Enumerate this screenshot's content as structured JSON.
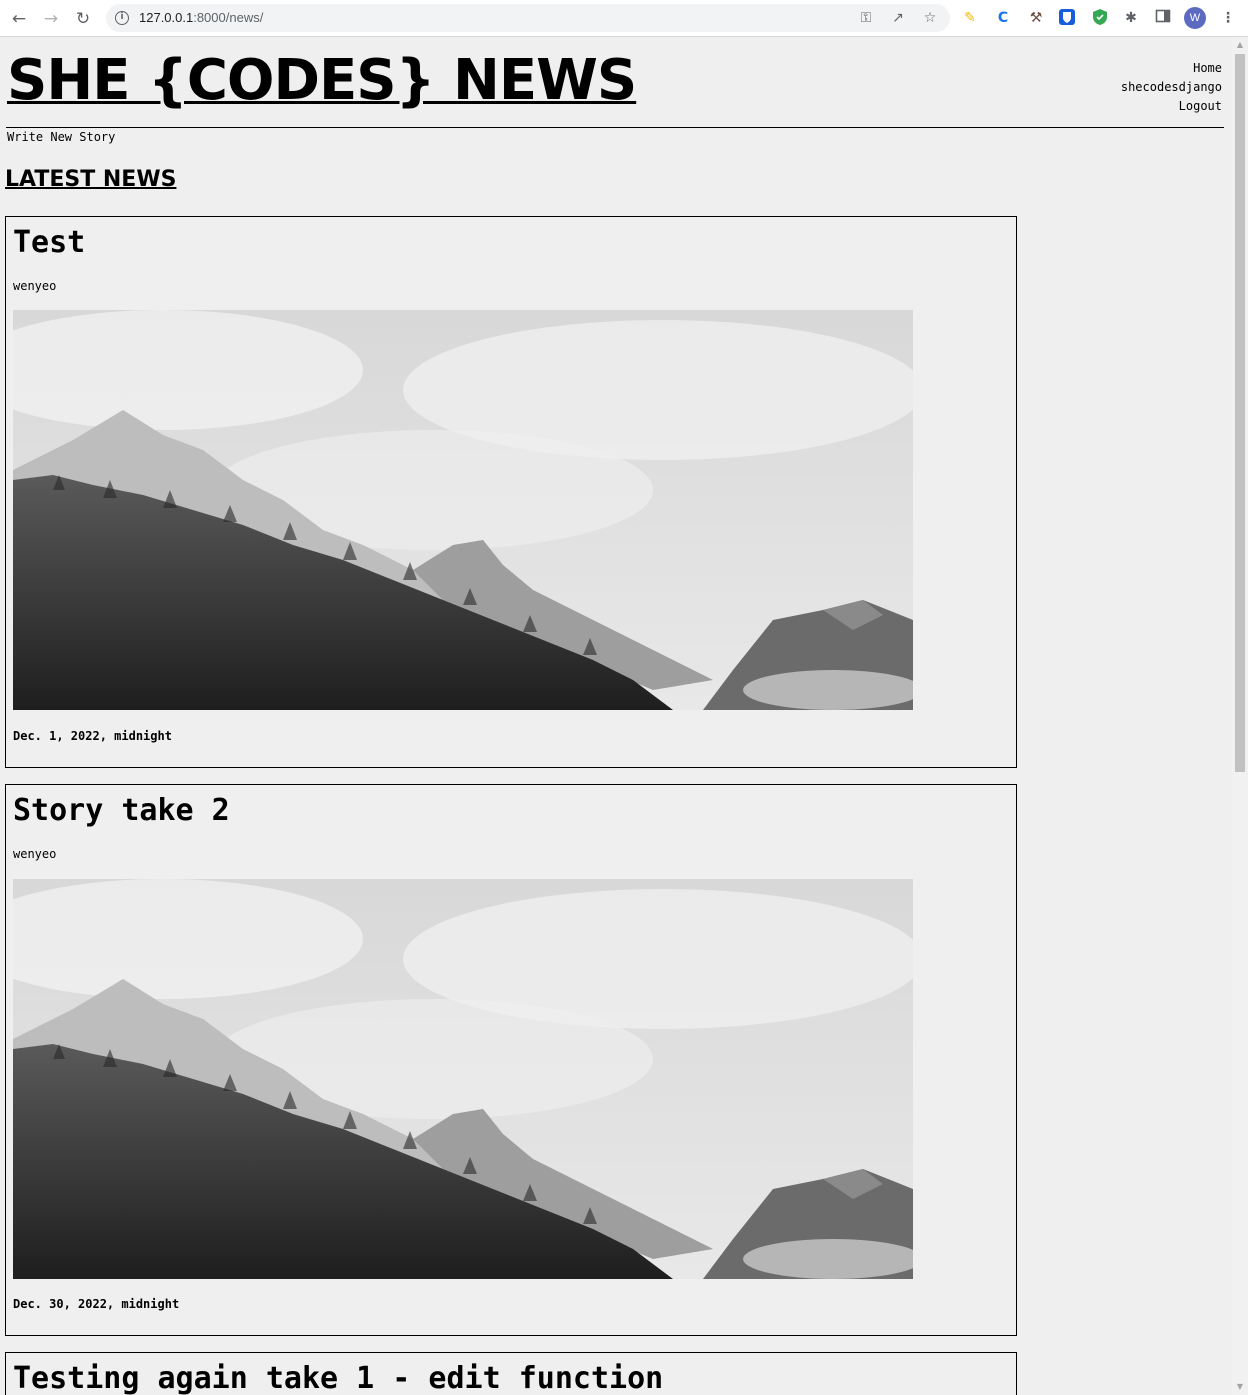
{
  "browser": {
    "url_host": "127.0.0.1",
    "url_path": ":8000/news/",
    "avatar_letter": "W"
  },
  "site": {
    "title": "SHE {CODES} NEWS",
    "nav": [
      "Home",
      "shecodesdjango",
      "Logout"
    ],
    "write_link": "Write New Story",
    "section_title": "LATEST NEWS"
  },
  "stories": [
    {
      "title": "Test",
      "author": "wenyeo",
      "date": "Dec. 1, 2022, midnight",
      "image": "mountain-forest-photo"
    },
    {
      "title": "Story take 2",
      "author": "wenyeo",
      "date": "Dec. 30, 2022, midnight",
      "image": "mountain-forest-photo"
    },
    {
      "title": "Testing again take 1 - edit function"
    }
  ]
}
